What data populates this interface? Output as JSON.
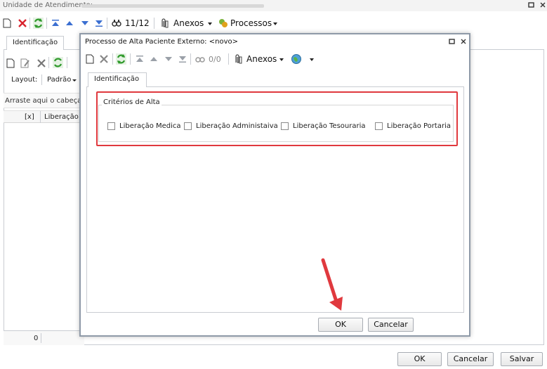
{
  "main": {
    "title_label": "Unidade de Atendimento:",
    "toolbar": {
      "record_position": "11/12",
      "anexos_label": "Anexos",
      "processos_label": "Processos"
    },
    "tab_label": "Identificação",
    "layout_label": "Layout:",
    "layout_value": "Padrão",
    "group_hint": "Arraste aqui o cabeçalh",
    "grid_columns": [
      "[x]",
      "Liberação M"
    ],
    "footer_count": "0",
    "buttons": {
      "ok": "OK",
      "cancel": "Cancelar",
      "save": "Salvar"
    }
  },
  "modal": {
    "title": "Processo de Alta Paciente Externo: <novo>",
    "toolbar": {
      "record_position": "0/0",
      "anexos_label": "Anexos"
    },
    "tab_label": "Identificação",
    "group_title": "Critérios de Alta",
    "checkboxes": [
      {
        "label": "Liberação Medica",
        "checked": false
      },
      {
        "label": "Liberação Administaiva",
        "checked": false
      },
      {
        "label": "Liberação Tesouraria",
        "checked": false
      },
      {
        "label": "Liberação Portaria",
        "checked": false
      }
    ],
    "buttons": {
      "ok": "OK",
      "cancel": "Cancelar"
    }
  },
  "colors": {
    "highlight": "#e0393e",
    "accent_green": "#2f9a2b",
    "delete_red": "#d9232e",
    "nav_blue": "#3b6fd1"
  },
  "icons": [
    "new-icon",
    "delete-icon",
    "refresh-icon",
    "first-record-icon",
    "prev-record-icon",
    "next-record-icon",
    "last-record-icon",
    "search-icon",
    "attachment-icon",
    "process-icon",
    "globe-icon",
    "restore-window-icon",
    "close-icon"
  ]
}
